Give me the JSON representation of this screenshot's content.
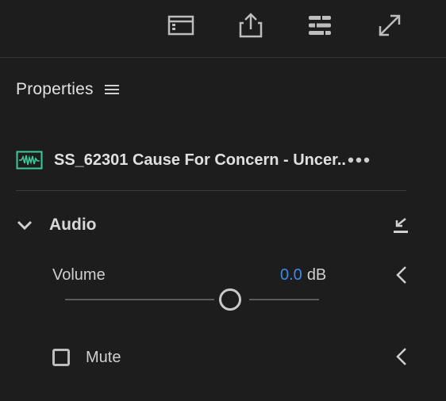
{
  "toolbar": {
    "buttons": [
      {
        "icon": "panel-layout-icon"
      },
      {
        "icon": "export-share-icon"
      },
      {
        "icon": "sliders-icon"
      },
      {
        "icon": "fullscreen-expand-icon"
      }
    ]
  },
  "panel": {
    "title": "Properties"
  },
  "clip": {
    "name": "SS_62301 Cause For Concern - Uncer..",
    "icon": "audio-waveform-icon",
    "icon_color": "#3ec99a"
  },
  "audio_section": {
    "title": "Audio",
    "volume": {
      "label": "Volume",
      "value": "0.0",
      "unit": "dB",
      "value_color": "#3a8be6"
    },
    "mute": {
      "label": "Mute",
      "checked": false
    }
  }
}
